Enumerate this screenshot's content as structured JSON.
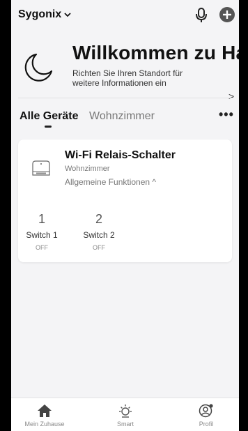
{
  "header": {
    "home_name": "Sygonix"
  },
  "welcome": {
    "title": "Willkommen zu Ha...",
    "subtitle": "Richten Sie Ihren Standort für weitere Informationen ein",
    "arrow": ">"
  },
  "tabs": {
    "all_devices": "Alle Geräte",
    "room": "Wohnzimmer",
    "more": "•••"
  },
  "device": {
    "name": "Wi-Fi Relais-Schalter",
    "room": "Wohnzimmer",
    "functions": "Allgemeine Funktionen ^",
    "switches": [
      {
        "icon": "1",
        "name": "Switch 1",
        "state": "OFF"
      },
      {
        "icon": "2",
        "name": "Switch 2",
        "state": "OFF"
      }
    ]
  },
  "bottom_nav": {
    "items": [
      {
        "label": "Mein Zuhause",
        "icon": "home-icon"
      },
      {
        "label": "Smart",
        "icon": "sun-icon"
      },
      {
        "label": "Profil",
        "icon": "profile-icon"
      }
    ]
  },
  "colors": {
    "background": "#f4f4f6",
    "card": "#ffffff",
    "text_primary": "#111111",
    "text_secondary": "#777777"
  }
}
